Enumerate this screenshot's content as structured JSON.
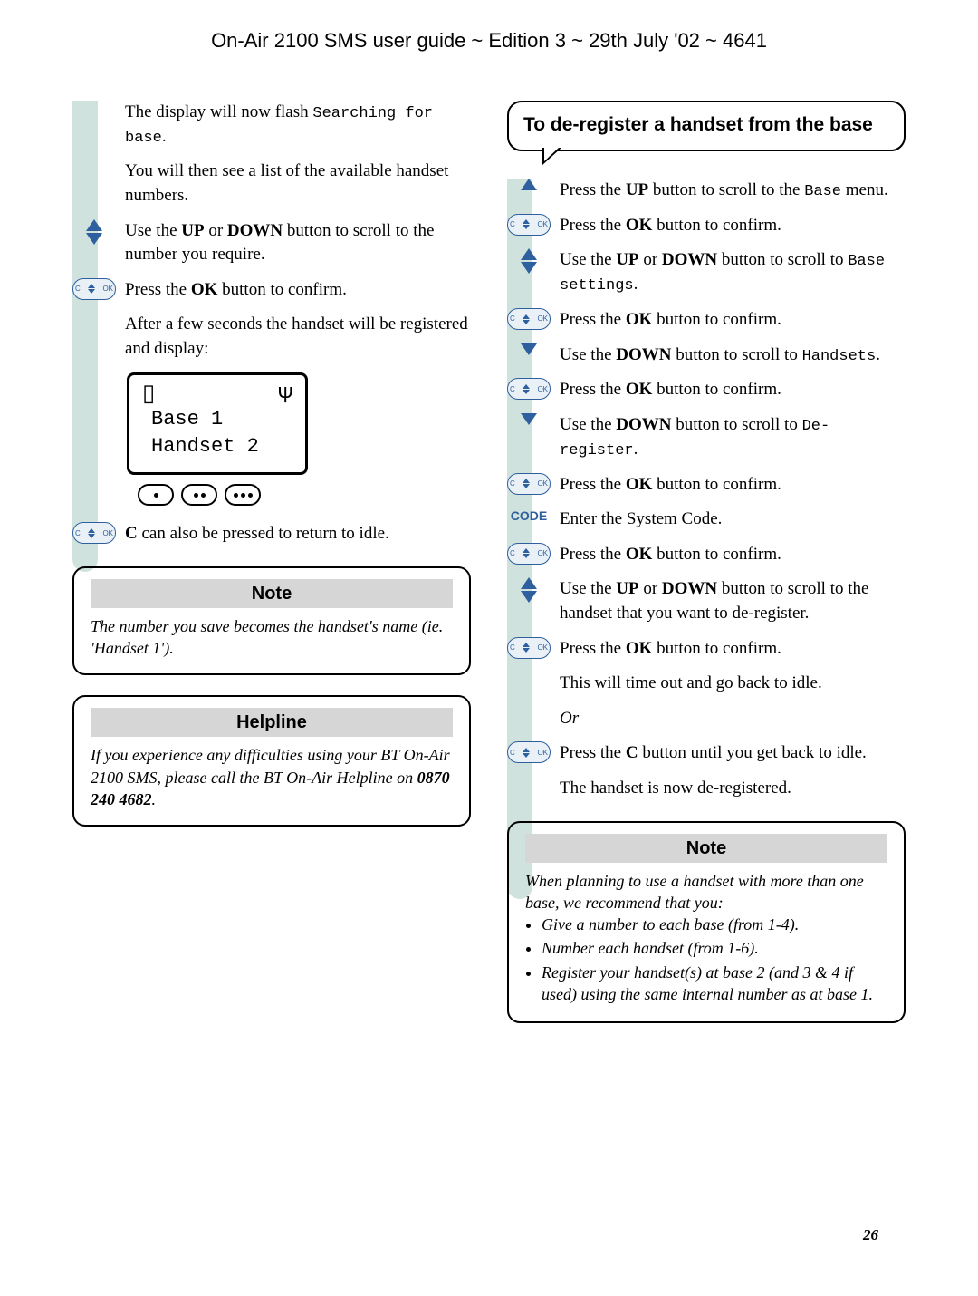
{
  "header": "On-Air 2100 SMS user guide ~ Edition 3 ~ 29th July '02 ~ 4641",
  "left": {
    "p1a": "The display will now flash ",
    "p1b": "Searching for base",
    "p1c": ".",
    "p2": "You will then see a list of the available handset numbers.",
    "p3a": "Use the ",
    "p3b": "UP",
    "p3c": " or ",
    "p3d": "DOWN",
    "p3e": " button to scroll to the number you require.",
    "p4a": "Press the ",
    "p4b": "OK",
    "p4c": " button to confirm.",
    "p5": "After a few seconds the handset will be registered and display:",
    "lcd_line1": "Base 1",
    "lcd_line2": "Handset 2",
    "p6a": "C",
    "p6b": " can also be pressed to return to idle.",
    "note_head": "Note",
    "note_body": "The number you save becomes the handset's name (ie. 'Handset 1').",
    "help_head": "Helpline",
    "help_body_a": "If you experience any difficulties using your BT On-Air 2100 SMS, please call the BT On-Air Helpline on ",
    "help_phone": "0870 240 4682",
    "help_body_b": "."
  },
  "right": {
    "callout": "To de-register a handset from the base",
    "s1a": "Press the ",
    "s1b": "UP",
    "s1c": " button to scroll to the ",
    "s1d": "Base",
    "s1e": " menu.",
    "s2a": "Press the ",
    "s2b": "OK",
    "s2c": " button to confirm.",
    "s3a": "Use the ",
    "s3b": "UP",
    "s3c": " or ",
    "s3d": "DOWN",
    "s3e": " button to scroll to ",
    "s3f": "Base settings",
    "s3g": ".",
    "s4a": "Press the ",
    "s4b": "OK",
    "s4c": " button to confirm.",
    "s5a": "Use the ",
    "s5b": "DOWN",
    "s5c": " button to scroll to ",
    "s5d": "Handsets",
    "s5e": ".",
    "s6a": "Press the ",
    "s6b": "OK",
    "s6c": " button to confirm.",
    "s7a": "Use the ",
    "s7b": "DOWN",
    "s7c": " button to scroll to ",
    "s7d": "De-register",
    "s7e": ".",
    "s8a": "Press the ",
    "s8b": "OK",
    "s8c": " button to confirm.",
    "code_label": "CODE",
    "s9": "Enter the System Code.",
    "s10a": "Press the ",
    "s10b": "OK",
    "s10c": " button to confirm.",
    "s11a": "Use the ",
    "s11b": "UP",
    "s11c": " or ",
    "s11d": "DOWN",
    "s11e": " button to scroll to the handset that you want to de-register.",
    "s12a": "Press the ",
    "s12b": "OK",
    "s12c": " button to confirm.",
    "s13": "This will time out and go back to idle.",
    "s14": "Or",
    "s15a": "Press the ",
    "s15b": "C",
    "s15c": " button until you get back to idle.",
    "s16": "The handset is now de-registered.",
    "note_head": "Note",
    "note_intro": "When planning to use a handset with more than one base, we recommend that you:",
    "note_b1": "Give a number to each base (from 1-4).",
    "note_b2": "Number each handset (from 1-6).",
    "note_b3": "Register your handset(s) at base 2 (and 3 & 4 if used) using the same internal number as at base 1."
  },
  "page_number": "26"
}
